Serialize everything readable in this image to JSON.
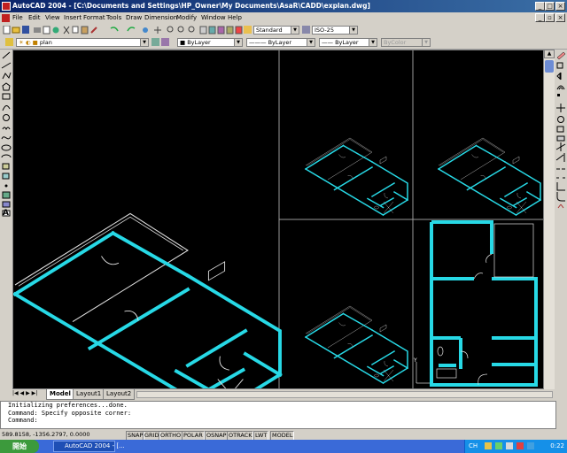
{
  "window": {
    "title": "AutoCAD 2004 - [C:\\Documents and Settings\\HP_Owner\\My Documents\\AsaR\\CADD\\explan.dwg]"
  },
  "menu": [
    "File",
    "Edit",
    "View",
    "Insert",
    "Format",
    "Tools",
    "Draw",
    "Dimension",
    "Modify",
    "Window",
    "Help"
  ],
  "toolbar": {
    "text_style": "Standard",
    "dim_style": "ISO-25"
  },
  "layers": {
    "current_layer": "plan",
    "color": "ByLayer",
    "linetype": "ByLayer",
    "lineweight": "ByLayer",
    "plot_style": "ByColor"
  },
  "layout_tabs": [
    "Model",
    "Layout1",
    "Layout2"
  ],
  "active_tab": "Model",
  "command_lines": [
    "Initializing preferences...done.",
    "Command: Specify opposite corner:",
    "Command:"
  ],
  "status": {
    "coords": "589.8158, -1356.2797, 0.0000",
    "toggles": [
      "SNAP",
      "GRID",
      "ORTHO",
      "POLAR",
      "OSNAP",
      "OTRACK",
      "LWT",
      "MODEL"
    ]
  },
  "taskbar": {
    "start_label": "開始",
    "app_item": "AutoCAD 2004 - [...",
    "language": "CH",
    "clock": "0:22"
  },
  "colors": {
    "wall": "#27d9e6",
    "outline": "#e0e0e0",
    "canvas": "#000000",
    "titlebar": "#0a246a"
  },
  "icons": {
    "left_toolbar": [
      "line-icon",
      "construction-line-icon",
      "polyline-icon",
      "polygon-icon",
      "rectangle-icon",
      "arc-icon",
      "circle-icon",
      "revision-cloud-icon",
      "spline-icon",
      "ellipse-icon",
      "ellipse-arc-icon",
      "insert-block-icon",
      "make-block-icon",
      "point-icon",
      "hatch-icon",
      "region-icon",
      "table-icon",
      "multiline-text-icon"
    ],
    "right_toolbar": [
      "erase-icon",
      "copy-icon",
      "mirror-icon",
      "offset-icon",
      "array-icon",
      "move-icon",
      "rotate-icon",
      "scale-icon",
      "stretch-icon",
      "trim-icon",
      "extend-icon",
      "break-at-point-icon",
      "break-icon",
      "chamfer-icon",
      "fillet-icon",
      "explode-icon"
    ]
  }
}
